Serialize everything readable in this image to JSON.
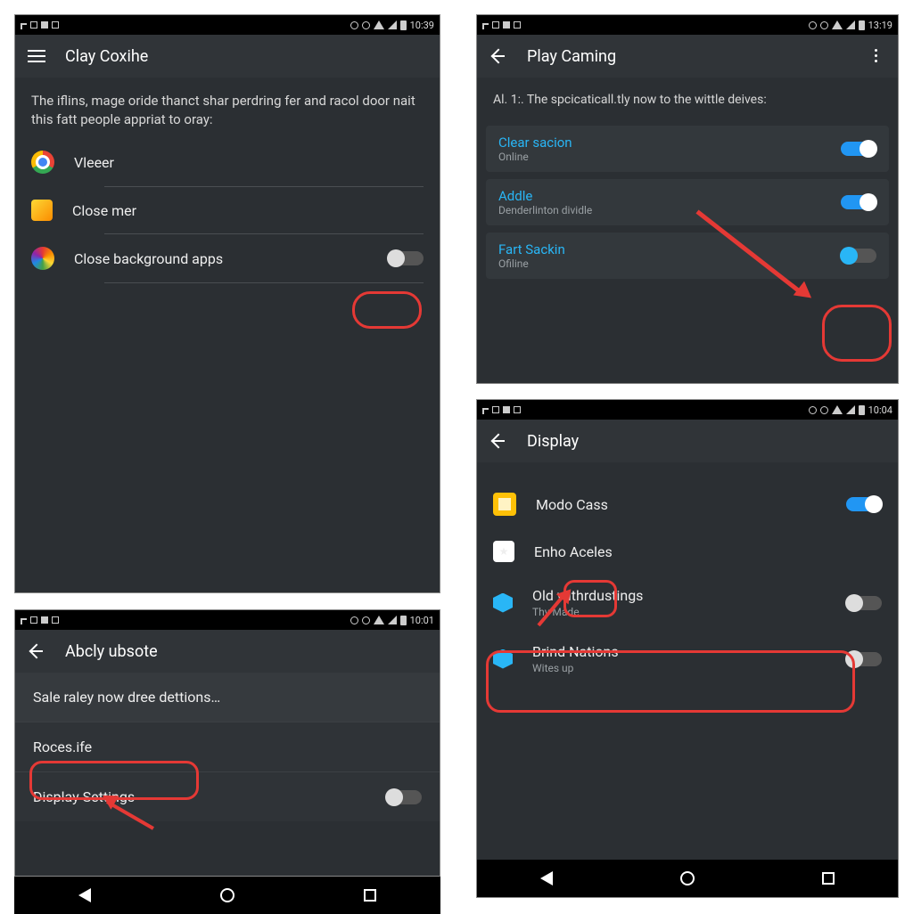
{
  "panel1": {
    "time": "10:39",
    "title": "Clay Coxihe",
    "description": "The iflins, mage oride thanct shar perdring fer and racol door nait this fatt people appriat to oray:",
    "items": [
      {
        "label": "Vleeer"
      },
      {
        "label": "Close mer"
      },
      {
        "label": "Close background apps"
      }
    ]
  },
  "panel2": {
    "time": "10:01",
    "title": "Abcly ubsote",
    "rows": [
      {
        "label": "Sale raley now dree dettions…"
      },
      {
        "label": "Roces.ife"
      },
      {
        "label": "Display Settings"
      }
    ]
  },
  "panel3": {
    "time": "13:19",
    "title": "Play Caming",
    "description": "Al. 1:. The spcicaticall.tly now to the wittle deives:",
    "items": [
      {
        "title": "Clear sacion",
        "sub": "Online",
        "on": true
      },
      {
        "title": "Addle",
        "sub": "Denderlinton dividle",
        "on": true
      },
      {
        "title": "Fart Sackin",
        "sub": "Ofiline",
        "on": false
      }
    ]
  },
  "panel4": {
    "time": "10:04",
    "title": "Display",
    "items": [
      {
        "label": "Modo Cass",
        "sub": "",
        "on": true
      },
      {
        "label": "Enho Aceles",
        "sub": "",
        "on": null
      },
      {
        "label": "Old withrdustings",
        "sub": "Thy Made",
        "on": false
      },
      {
        "label": "Brind Nations",
        "sub": "Wites up",
        "on": false
      }
    ]
  }
}
